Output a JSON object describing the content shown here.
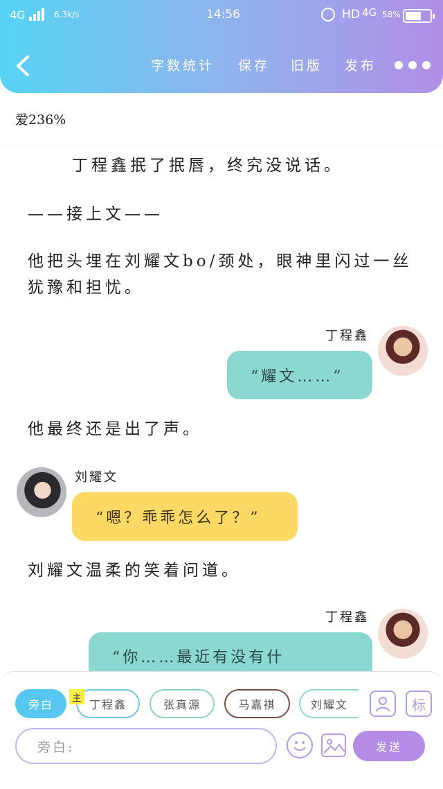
{
  "status_bar": {
    "network": "4G",
    "speed": "6.3k/s",
    "time": "14:56",
    "hd": "HD",
    "network2": "4G",
    "battery": "58%"
  },
  "toolbar": {
    "word_count": "字数统计",
    "save": "保存",
    "old_version": "旧版",
    "publish": "发布"
  },
  "counter": "爱236%",
  "story": [
    {
      "type": "text",
      "text": "丁程鑫抿了抿唇，终究没说话。"
    },
    {
      "type": "text",
      "text": "——接上文——"
    },
    {
      "type": "text",
      "line1": "他把头埋在刘耀文bo/颈处，眼神里闪过一丝",
      "line2": "犹豫和担忧。"
    },
    {
      "type": "dialogue",
      "speaker": "丁程鑫",
      "text": "“耀文……”"
    },
    {
      "type": "text",
      "text": "他最终还是出了声。"
    },
    {
      "type": "dialogue",
      "speaker": "刘耀文",
      "text": "“嗯？乖乖怎么了？”"
    },
    {
      "type": "text",
      "text": "刘耀文温柔的笑着问道。"
    },
    {
      "type": "dialogue",
      "speaker": "丁程鑫",
      "text": "“你……最近有没有什"
    }
  ],
  "roles": {
    "narration": "旁白",
    "main_tag": "主",
    "ding": "丁程鑫",
    "zhang": "张真源",
    "ma": "马嘉祺",
    "liu": "刘耀文",
    "mark_icon": "标"
  },
  "input": {
    "placeholder": "旁白:"
  },
  "send_label": "发送",
  "colors": {
    "header_start": "#56d3f4",
    "header_end": "#b18fe6",
    "bubble_teal": "#8ad8d0",
    "bubble_yellow": "#fcd964",
    "accent_purple": "#b48be6"
  }
}
